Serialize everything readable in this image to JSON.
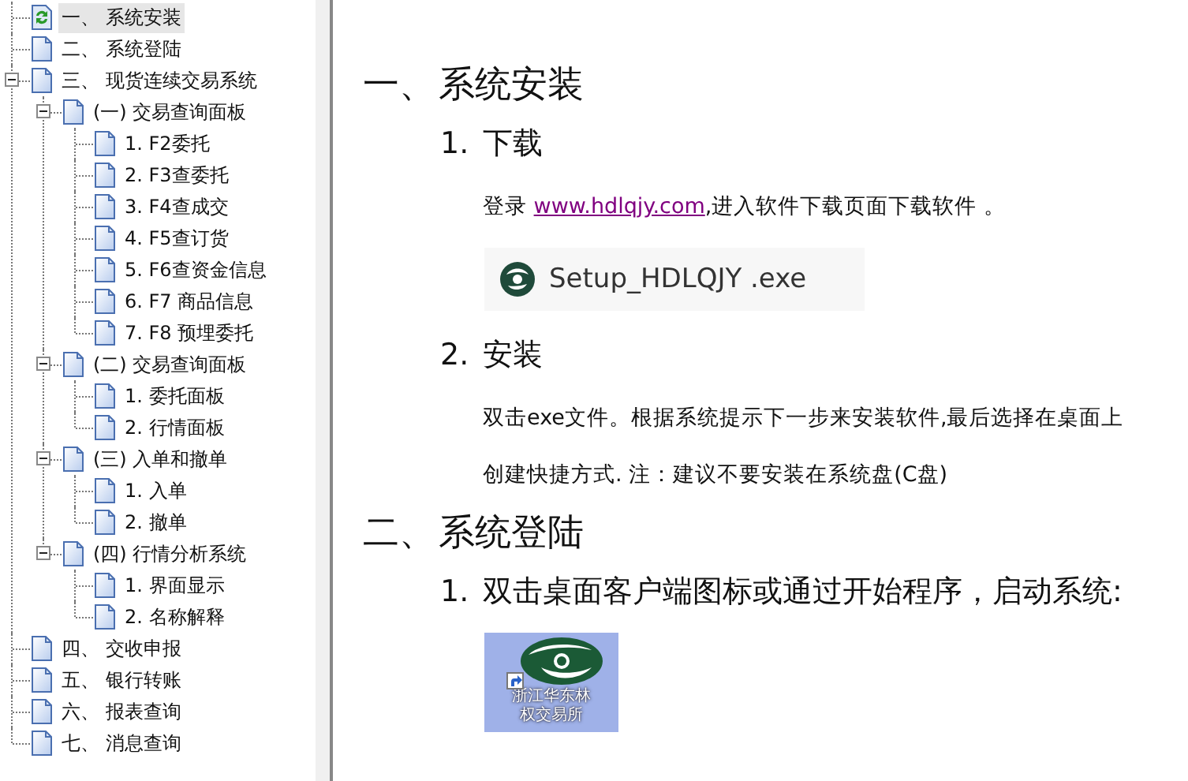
{
  "tree": [
    {
      "label": "一、 系统安装",
      "kind": "refresh",
      "selected": true
    },
    {
      "label": "二、 系统登陆",
      "kind": "page",
      "selected": false
    },
    {
      "label": "三、 现货连续交易系统",
      "kind": "page",
      "selected": false,
      "expanded": true,
      "children": [
        {
          "label": "(一) 交易查询面板",
          "kind": "page",
          "selected": false,
          "expanded": true,
          "children": [
            {
              "label": "1. F2委托",
              "kind": "page",
              "selected": false
            },
            {
              "label": "2. F3查委托",
              "kind": "page",
              "selected": false
            },
            {
              "label": "3. F4查成交",
              "kind": "page",
              "selected": false
            },
            {
              "label": "4. F5查订货",
              "kind": "page",
              "selected": false
            },
            {
              "label": "5. F6查资金信息",
              "kind": "page",
              "selected": false
            },
            {
              "label": "6. F7 商品信息",
              "kind": "page",
              "selected": false
            },
            {
              "label": "7. F8 预埋委托",
              "kind": "page",
              "selected": false
            }
          ]
        },
        {
          "label": "(二) 交易查询面板",
          "kind": "page",
          "selected": false,
          "expanded": true,
          "children": [
            {
              "label": "1. 委托面板",
              "kind": "page",
              "selected": false
            },
            {
              "label": "2. 行情面板",
              "kind": "page",
              "selected": false
            }
          ]
        },
        {
          "label": "(三) 入单和撤单",
          "kind": "page",
          "selected": false,
          "expanded": true,
          "children": [
            {
              "label": "1. 入单",
              "kind": "page",
              "selected": false
            },
            {
              "label": "2. 撤单",
              "kind": "page",
              "selected": false
            }
          ]
        },
        {
          "label": "(四) 行情分析系统",
          "kind": "page",
          "selected": false,
          "expanded": true,
          "children": [
            {
              "label": "1. 界面显示",
              "kind": "page",
              "selected": false
            },
            {
              "label": "2. 名称解释",
              "kind": "page",
              "selected": false
            }
          ]
        }
      ]
    },
    {
      "label": "四、 交收申报",
      "kind": "page",
      "selected": false
    },
    {
      "label": "五、 银行转账",
      "kind": "page",
      "selected": false
    },
    {
      "label": "六、 报表查询",
      "kind": "page",
      "selected": false
    },
    {
      "label": "七、 消息查询",
      "kind": "page",
      "selected": false
    }
  ],
  "document": [
    {
      "kind": "heading1",
      "number": "一、",
      "title": "系统安装"
    },
    {
      "kind": "heading2",
      "number": "1.",
      "title": "下载"
    },
    {
      "kind": "paragraph",
      "text": "登录 ",
      "link": "www.hdlqjy.com",
      "after": ",进入软件下载页面下载软件 。"
    },
    {
      "kind": "file",
      "name": "Setup_HDLQJY .exe"
    },
    {
      "kind": "heading2",
      "number": "2.",
      "title": "安装"
    },
    {
      "kind": "paragraph",
      "text": "双击exe文件。根据系统提示下一步来安装软件,最后选择在桌面上"
    },
    {
      "kind": "paragraph",
      "text": "创建快捷方式. 注：建议不要安装在系统盘(C盘)"
    },
    {
      "kind": "heading1",
      "number": "二、",
      "title": "系统登陆"
    },
    {
      "kind": "heading2",
      "number": "1.",
      "title": "双击桌面客户端图标或通过开始程序，启动系统:"
    },
    {
      "kind": "shortcut",
      "label": "浙江华东林权交易所"
    }
  ]
}
